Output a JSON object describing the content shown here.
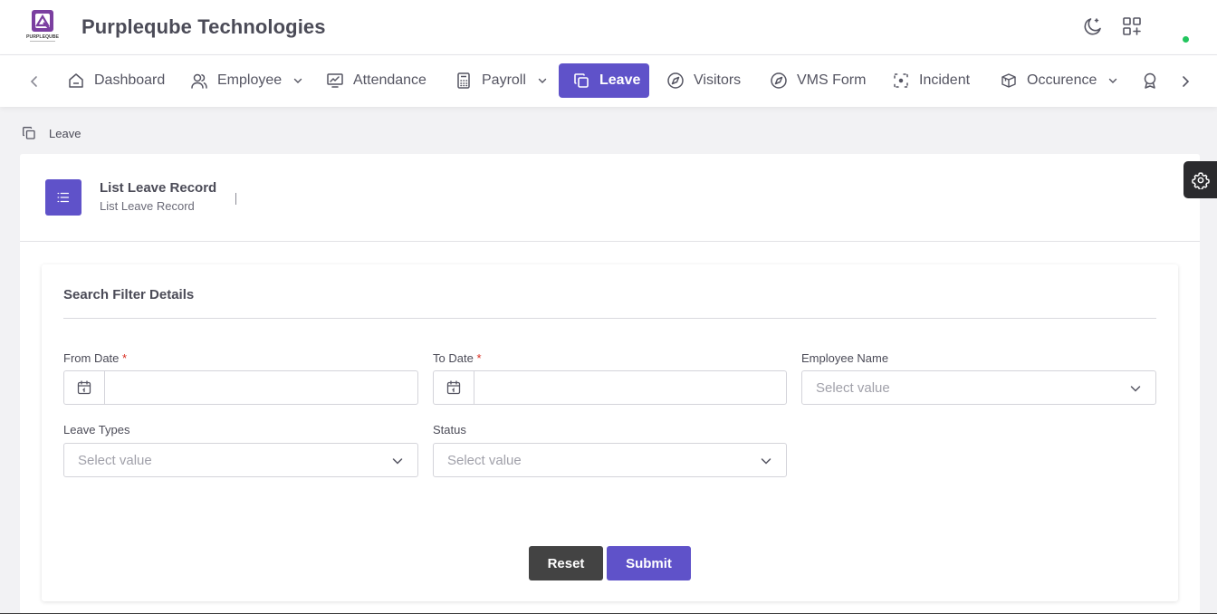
{
  "app": {
    "brand_name": "Purpleqube Technologies",
    "logo_text": "PURPLEQUBE",
    "accent_color": "#5f52c9",
    "status_color": "#22c55e"
  },
  "nav": {
    "items": [
      {
        "label": "Dashboard",
        "icon": "home-icon"
      },
      {
        "label": "Employee",
        "icon": "users-icon",
        "has_dropdown": true
      },
      {
        "label": "Attendance",
        "icon": "monitor-chart-icon"
      },
      {
        "label": "Payroll",
        "icon": "calculator-icon",
        "has_dropdown": true
      },
      {
        "label": "Leave",
        "icon": "copy-icon",
        "active": true
      },
      {
        "label": "Visitors",
        "icon": "compass-icon"
      },
      {
        "label": "VMS Form",
        "icon": "compass-icon"
      },
      {
        "label": "Incident",
        "icon": "focus-icon"
      },
      {
        "label": "Occurence",
        "icon": "boxes-icon",
        "has_dropdown": true
      }
    ]
  },
  "breadcrumb": {
    "label": "Leave"
  },
  "page": {
    "title": "List Leave Record",
    "subtitle": "List Leave Record"
  },
  "filter": {
    "title": "Search Filter Details",
    "from_date": {
      "label": "From Date",
      "required_mark": "*",
      "value": ""
    },
    "to_date": {
      "label": "To Date",
      "required_mark": "*",
      "value": ""
    },
    "employee_name": {
      "label": "Employee Name",
      "placeholder": "Select value"
    },
    "leave_types": {
      "label": "Leave Types",
      "placeholder": "Select value"
    },
    "status": {
      "label": "Status",
      "placeholder": "Select value"
    }
  },
  "actions": {
    "reset_label": "Reset",
    "submit_label": "Submit"
  }
}
